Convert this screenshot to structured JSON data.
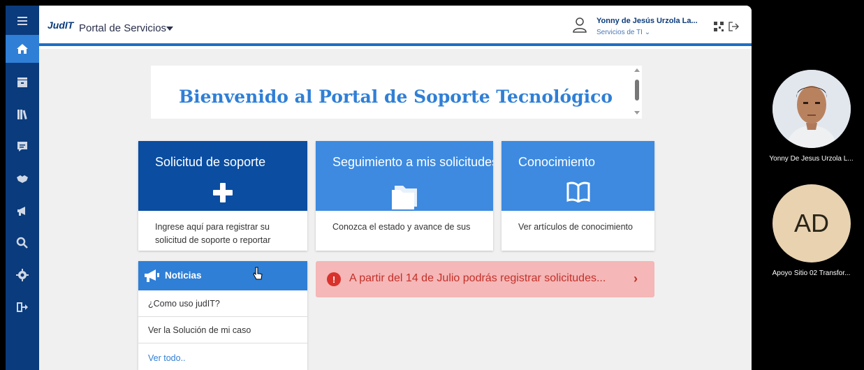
{
  "header": {
    "logo_text": "JudIT",
    "portal_name": "Portal de Servicios",
    "user_name": "Yonny de Jesús Urzola La...",
    "user_dept": "Servicios de TI ⌄"
  },
  "sidebar": {
    "items": [
      {
        "icon": "menu-icon"
      },
      {
        "icon": "home-icon",
        "active": true
      },
      {
        "icon": "inbox-icon"
      },
      {
        "icon": "library-icon"
      },
      {
        "icon": "chat-icon"
      },
      {
        "icon": "handshake-icon"
      },
      {
        "icon": "megaphone-icon"
      },
      {
        "icon": "search-icon"
      },
      {
        "icon": "gear-icon"
      },
      {
        "icon": "logout-icon"
      }
    ]
  },
  "welcome": {
    "title": "Bienvenido al Portal de Soporte Tecnológico"
  },
  "cards": [
    {
      "title": "Solicitud de soporte",
      "body": "Ingrese aquí para registrar su solicitud de soporte o reportar",
      "color": "#0a4da1",
      "icon": "plus-icon"
    },
    {
      "title": "Seguimiento a mis solicitudes",
      "body": "Conozca el estado y avance de sus",
      "color": "#3d8ae0",
      "icon": "folder-icon"
    },
    {
      "title": "Conocimiento",
      "body": "Ver artículos de conocimiento",
      "color": "#3d8ae0",
      "icon": "book-icon"
    }
  ],
  "news": {
    "title": "Noticias",
    "items": [
      "¿Como uso judIT?",
      "Ver la Solución de mi caso"
    ],
    "more": "Ver todo.."
  },
  "alert": {
    "icon": "!",
    "text": "A partir del 14 de Julio podrás registrar solicitudes...",
    "arrow": "›"
  },
  "participants": [
    {
      "name": "Yonny De Jesus Urzola L...",
      "type": "photo"
    },
    {
      "name": "Apoyo Sitio 02 Transfor...",
      "initials": "AD"
    }
  ]
}
